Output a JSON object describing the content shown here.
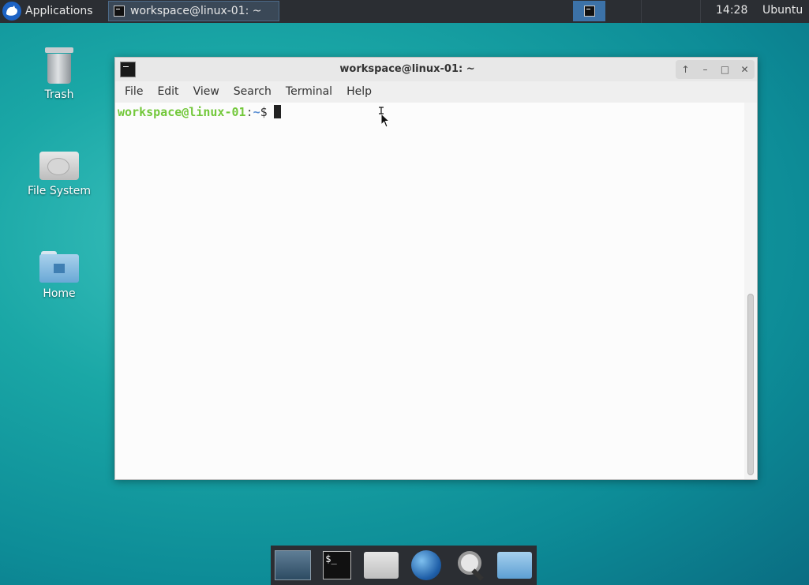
{
  "top_panel": {
    "applications_label": "Applications",
    "task_window_title": "workspace@linux-01: ~",
    "clock": "14:28",
    "user": "Ubuntu"
  },
  "desktop_icons": [
    {
      "label": "Trash",
      "icon": "trash-icon"
    },
    {
      "label": "File System",
      "icon": "hard-drive-icon"
    },
    {
      "label": "Home",
      "icon": "home-folder-icon"
    }
  ],
  "window": {
    "title": "workspace@linux-01: ~",
    "controls": [
      "↑",
      "–",
      "□",
      "✕"
    ],
    "menu": [
      "File",
      "Edit",
      "View",
      "Search",
      "Terminal",
      "Help"
    ],
    "prompt": {
      "user_host": "workspace@linux-01",
      "separator": ":",
      "path": "~",
      "symbol": "$"
    }
  },
  "dock": [
    {
      "name": "show-desktop"
    },
    {
      "name": "terminal",
      "glyph": "$_"
    },
    {
      "name": "home-folder"
    },
    {
      "name": "web-browser"
    },
    {
      "name": "app-finder"
    },
    {
      "name": "file-manager"
    }
  ],
  "colors": {
    "panel": "#2b2e33",
    "prompt_user": "#73c83b",
    "prompt_path": "#5b8fd3",
    "active_workspace": "#3c72a8"
  }
}
